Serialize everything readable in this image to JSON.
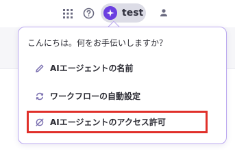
{
  "topbar": {
    "user_name": "test",
    "icons": [
      "apps-grid-icon",
      "help-circle-icon",
      "user-avatar-icon",
      "person-icon"
    ]
  },
  "popup": {
    "greeting": "こんにちは。何をお手伝いしますか？",
    "items": [
      {
        "label": "AIエージェントの名前",
        "icon": "pencil-icon"
      },
      {
        "label": "ワークフローの自動設定",
        "icon": "refresh-icon"
      },
      {
        "label": "AIエージェントのアクセス許可",
        "icon": "no-access-icon",
        "highlighted": true
      }
    ]
  },
  "colors": {
    "accent": "#6b3fe0",
    "popup_border": "#b9a6ef",
    "highlight": "#e0302a",
    "icon_muted": "#7a6fb0"
  }
}
